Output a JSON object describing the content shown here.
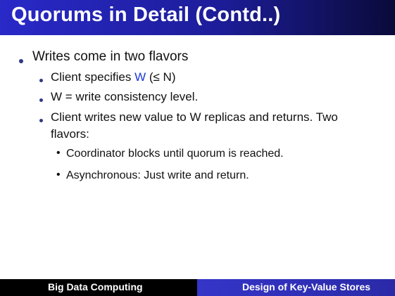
{
  "slide": {
    "title": "Quorums in Detail (Contd..)",
    "bullets": {
      "b1": "Writes come in two flavors",
      "b2_prefix": "Client specifies ",
      "b2_highlight": "W",
      "b2_suffix": " (≤ N)",
      "b3": "W = write consistency level.",
      "b4_line1": "Client writes new value to W replicas and returns. Two",
      "b4_line2": "flavors:",
      "b5": "Coordinator blocks until quorum is reached.",
      "b6": "Asynchronous: Just write and return."
    },
    "round_bullet_glyph": "•"
  },
  "footer": {
    "left": "Big Data Computing",
    "right": "Design of Key-Value Stores"
  },
  "colors": {
    "title_bar": "#2929c8",
    "bullet": "#2e3a82",
    "highlight": "#1a36d8",
    "footer_left": "#000000",
    "footer_right": "#3535c8"
  }
}
